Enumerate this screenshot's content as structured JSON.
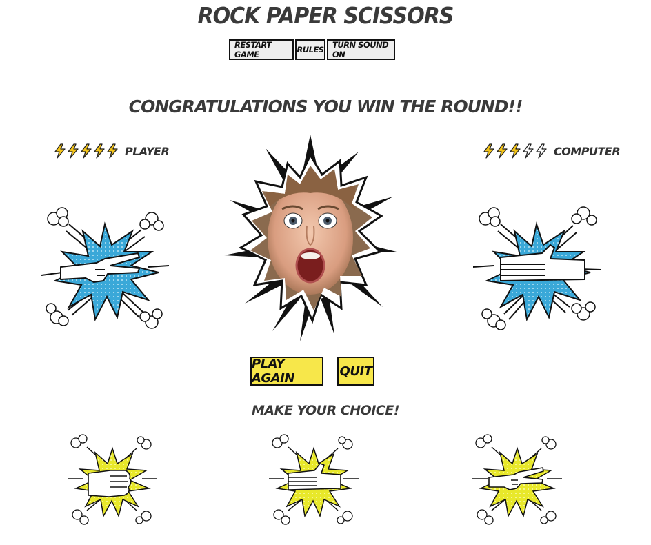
{
  "title": "ROCK PAPER SCISSORS",
  "menu": {
    "restart": "RESTART GAME",
    "rules": "RULES",
    "sound": "TURN SOUND ON"
  },
  "message": "CONGRATULATIONS YOU WIN THE ROUND!!",
  "player": {
    "label": "PLAYER",
    "lives_filled": 5,
    "lives_total": 5,
    "hand": "scissors"
  },
  "computer": {
    "label": "COMPUTER",
    "lives_filled": 3,
    "lives_total": 5,
    "hand": "paper"
  },
  "actions": {
    "play_again": "PLAY AGAIN",
    "quit": "QUIT"
  },
  "prompt": "MAKE YOUR CHOICE!",
  "choices": [
    "rock",
    "paper",
    "scissors"
  ],
  "colors": {
    "accent_yellow": "#f7e74a",
    "burst_blue": "#3aa8d8",
    "burst_yellow": "#e8e82a",
    "bolt_yellow": "#f5c518"
  }
}
